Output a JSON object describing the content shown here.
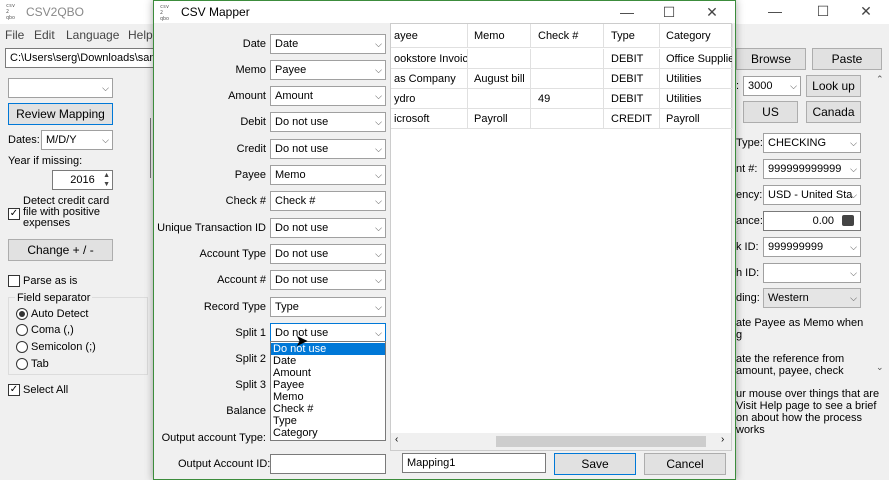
{
  "app": {
    "title": "CSV2QBO",
    "icon_text": "csv 2 qbo",
    "window_controls": [
      "—",
      "☐",
      "✕"
    ]
  },
  "menu": [
    "File",
    "Edit",
    "Language",
    "Help"
  ],
  "left_panel": {
    "path_value": "C:\\Users\\serg\\Downloads\\sampl",
    "top_combo_value": "",
    "review_button": "Review Mapping",
    "dates_label": "Dates:",
    "dates_value": "M/D/Y",
    "year_label": "Year if missing:",
    "year_value": "2016",
    "detect_cc_label": "Detect credit card file with positive expenses",
    "change_button": "Change + / -",
    "parse_as_is": "Parse as is",
    "field_separator_label": "Field separator",
    "separators": [
      "Auto Detect",
      "Coma (,)",
      "Semicolon (;)",
      "Tab"
    ],
    "select_all": "Select All"
  },
  "right_panel": {
    "browse": "Browse",
    "paste": "Paste",
    "number_prefix": ":",
    "number_value": "3000",
    "lookup": "Look up",
    "us": "US",
    "canada": "Canada",
    "rows": [
      {
        "label": "Type:",
        "value": "CHECKING",
        "kind": "combo"
      },
      {
        "label": "nt #:",
        "value": "999999999999",
        "kind": "combo"
      },
      {
        "label": "ency:",
        "value": "USD - United Sta",
        "kind": "combo"
      },
      {
        "label": "ance:",
        "value": "0.00",
        "kind": "field"
      },
      {
        "label": "k ID:",
        "value": "999999999",
        "kind": "combo"
      },
      {
        "label": "h ID:",
        "value": "",
        "kind": "combo"
      },
      {
        "label": "ding:",
        "value": "Western",
        "kind": "drop"
      }
    ],
    "payee_memo_text": "ate Payee as Memo when\ng",
    "reference_text": "ate the reference from\namount, payee, check",
    "help_text": "ur mouse over things that are\nVisit Help page to see a brief\non about how the process works"
  },
  "dialog": {
    "title": "CSV Mapper",
    "icon_text": "csv 2 qbo",
    "controls": [
      "—",
      "☐",
      "✕"
    ],
    "mappings": [
      {
        "label": "Date",
        "value": "Date"
      },
      {
        "label": "Memo",
        "value": "Payee"
      },
      {
        "label": "Amount",
        "value": "Amount"
      },
      {
        "label": "Debit",
        "value": "Do not use"
      },
      {
        "label": "Credit",
        "value": "Do not use"
      },
      {
        "label": "Payee",
        "value": "Memo"
      },
      {
        "label": "Check #",
        "value": "Check #"
      },
      {
        "label": "Unique Transaction ID",
        "value": "Do not use"
      },
      {
        "label": "Account Type",
        "value": "Do not use"
      },
      {
        "label": "Account #",
        "value": "Do not use"
      },
      {
        "label": "Record Type",
        "value": "Type"
      },
      {
        "label": "Split 1",
        "value": "Do not use"
      },
      {
        "label": "Split 2",
        "value": ""
      },
      {
        "label": "Split 3",
        "value": ""
      },
      {
        "label": "Balance",
        "value": ""
      },
      {
        "label": "Output account Type:",
        "value": ""
      }
    ],
    "output_account_id_label": "Output Account ID:",
    "output_account_id_value": "",
    "dropdown_options": [
      "Do not use",
      "Date",
      "Amount",
      "Payee",
      "Memo",
      "Check #",
      "Type",
      "Category"
    ],
    "mapping_name": "Mapping1",
    "save": "Save",
    "cancel": "Cancel",
    "table": {
      "headers": [
        "ayee",
        "Memo",
        "Check #",
        "Type",
        "Category"
      ],
      "rows": [
        [
          "ookstore Invoice",
          "",
          "",
          "DEBIT",
          "Office Supplies"
        ],
        [
          "as Company",
          "August bill",
          "",
          "DEBIT",
          "Utilities"
        ],
        [
          "ydro",
          "",
          "49",
          "DEBIT",
          "Utilities"
        ],
        [
          "icrosoft",
          "Payroll",
          "",
          "CREDIT",
          "Payroll"
        ]
      ]
    }
  }
}
